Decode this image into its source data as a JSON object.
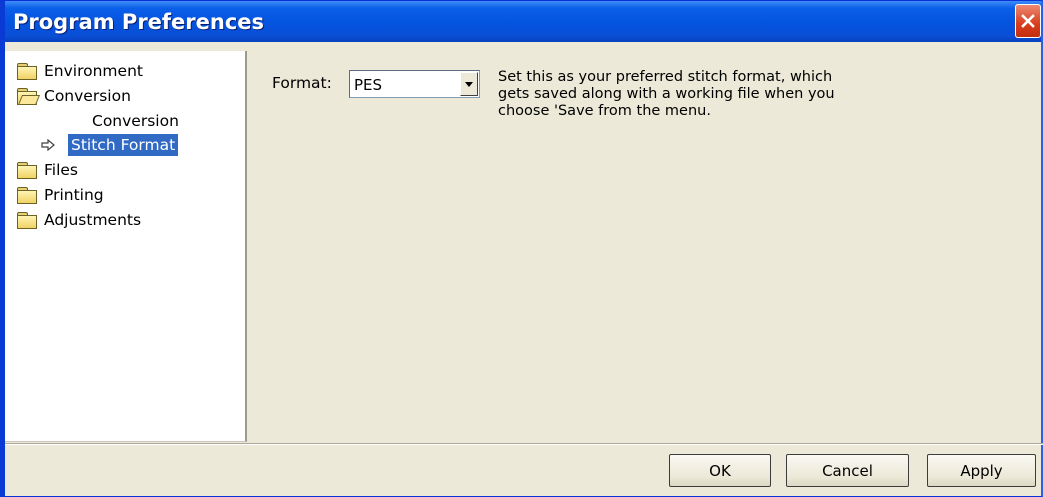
{
  "window": {
    "title": "Program Preferences"
  },
  "tree": {
    "items": [
      {
        "label": "Environment",
        "icon": "folder-closed-icon"
      },
      {
        "label": "Conversion",
        "icon": "folder-open-icon"
      },
      {
        "label": "Conversion",
        "icon": ""
      },
      {
        "label": "Stitch Format",
        "icon": "arrow-right-icon",
        "selected": true
      },
      {
        "label": "Files",
        "icon": "folder-closed-icon"
      },
      {
        "label": "Printing",
        "icon": "folder-closed-icon"
      },
      {
        "label": "Adjustments",
        "icon": "folder-closed-icon"
      }
    ]
  },
  "settings": {
    "format_label": "Format:",
    "format_value": "PES",
    "description_lines": [
      "Set this as your preferred stitch format, which",
      "gets saved along with a working file when you",
      "choose 'Save from the menu."
    ]
  },
  "buttons": {
    "ok": "OK",
    "cancel": "Cancel",
    "apply": "Apply"
  },
  "colors": {
    "title_bar": "#0a5fe9",
    "selection": "#316ac5",
    "dialog_bg": "#ece9d8",
    "close_button": "#d83c1c"
  }
}
